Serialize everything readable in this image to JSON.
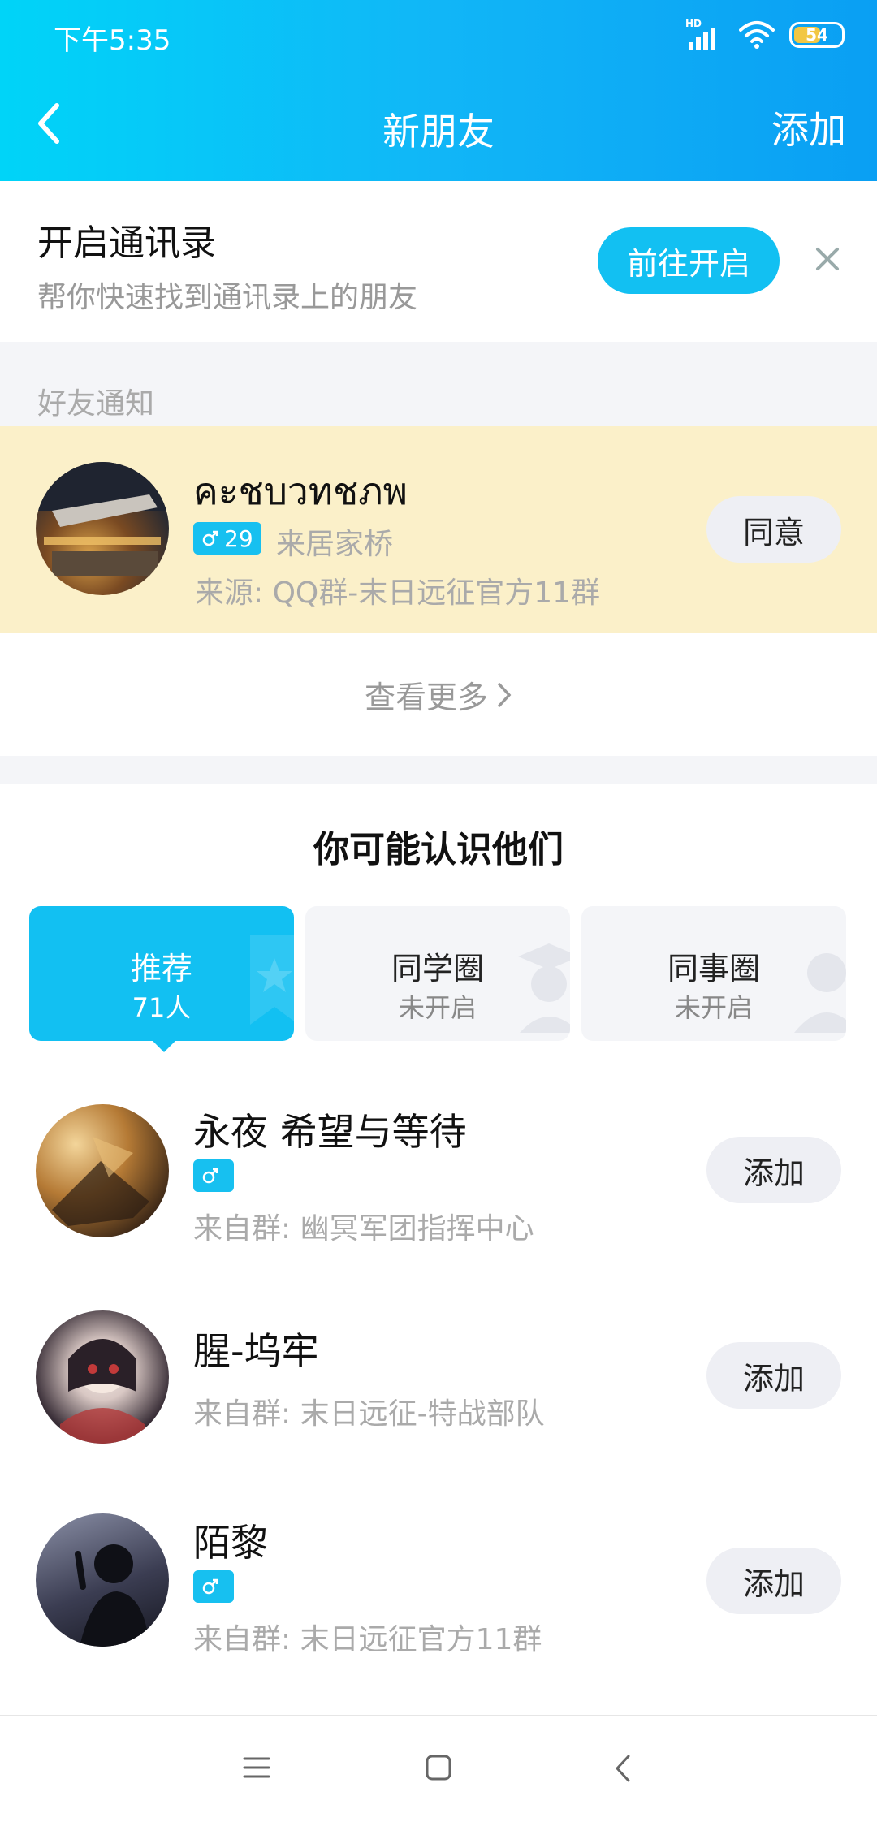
{
  "status_bar": {
    "time": "下午5:35",
    "network": "HD",
    "battery": "54"
  },
  "nav": {
    "title": "新朋友",
    "action": "添加"
  },
  "contacts_banner": {
    "title": "开启通讯录",
    "subtitle": "帮你快速找到通讯录上的朋友",
    "button": "前往开启"
  },
  "friend_notice": {
    "section_label": "好友通知",
    "name": "คะชบวทชภพ",
    "age": "29",
    "location": "来居家桥",
    "source": "来源: QQ群-末日远征官方11群",
    "button": "同意"
  },
  "see_more": "查看更多",
  "suggest": {
    "title": "你可能认识他们",
    "tabs": [
      {
        "title": "推荐",
        "sub": "71人"
      },
      {
        "title": "同学圈",
        "sub": "未开启"
      },
      {
        "title": "同事圈",
        "sub": "未开启"
      }
    ],
    "people": [
      {
        "name": "永夜 希望与等待",
        "source": "来自群: 幽冥军团指挥中心",
        "button": "添加"
      },
      {
        "name": "腥-坞牢",
        "source": "来自群: 末日远征-特战部队",
        "button": "添加"
      },
      {
        "name": "陌黎",
        "source": "来自群: 末日远征官方11群",
        "button": "添加"
      }
    ]
  },
  "icons": {
    "back": "chevron-left-icon",
    "close": "close-icon",
    "gender": "male-icon",
    "see_more": "chevron-right-icon",
    "menu": "menu-icon",
    "home": "square-icon",
    "nav_back": "back-triangle-icon"
  },
  "colors": {
    "accent": "#12c0f2",
    "notice_bg": "#fbf0c9",
    "page_gap": "#f4f5f8"
  }
}
